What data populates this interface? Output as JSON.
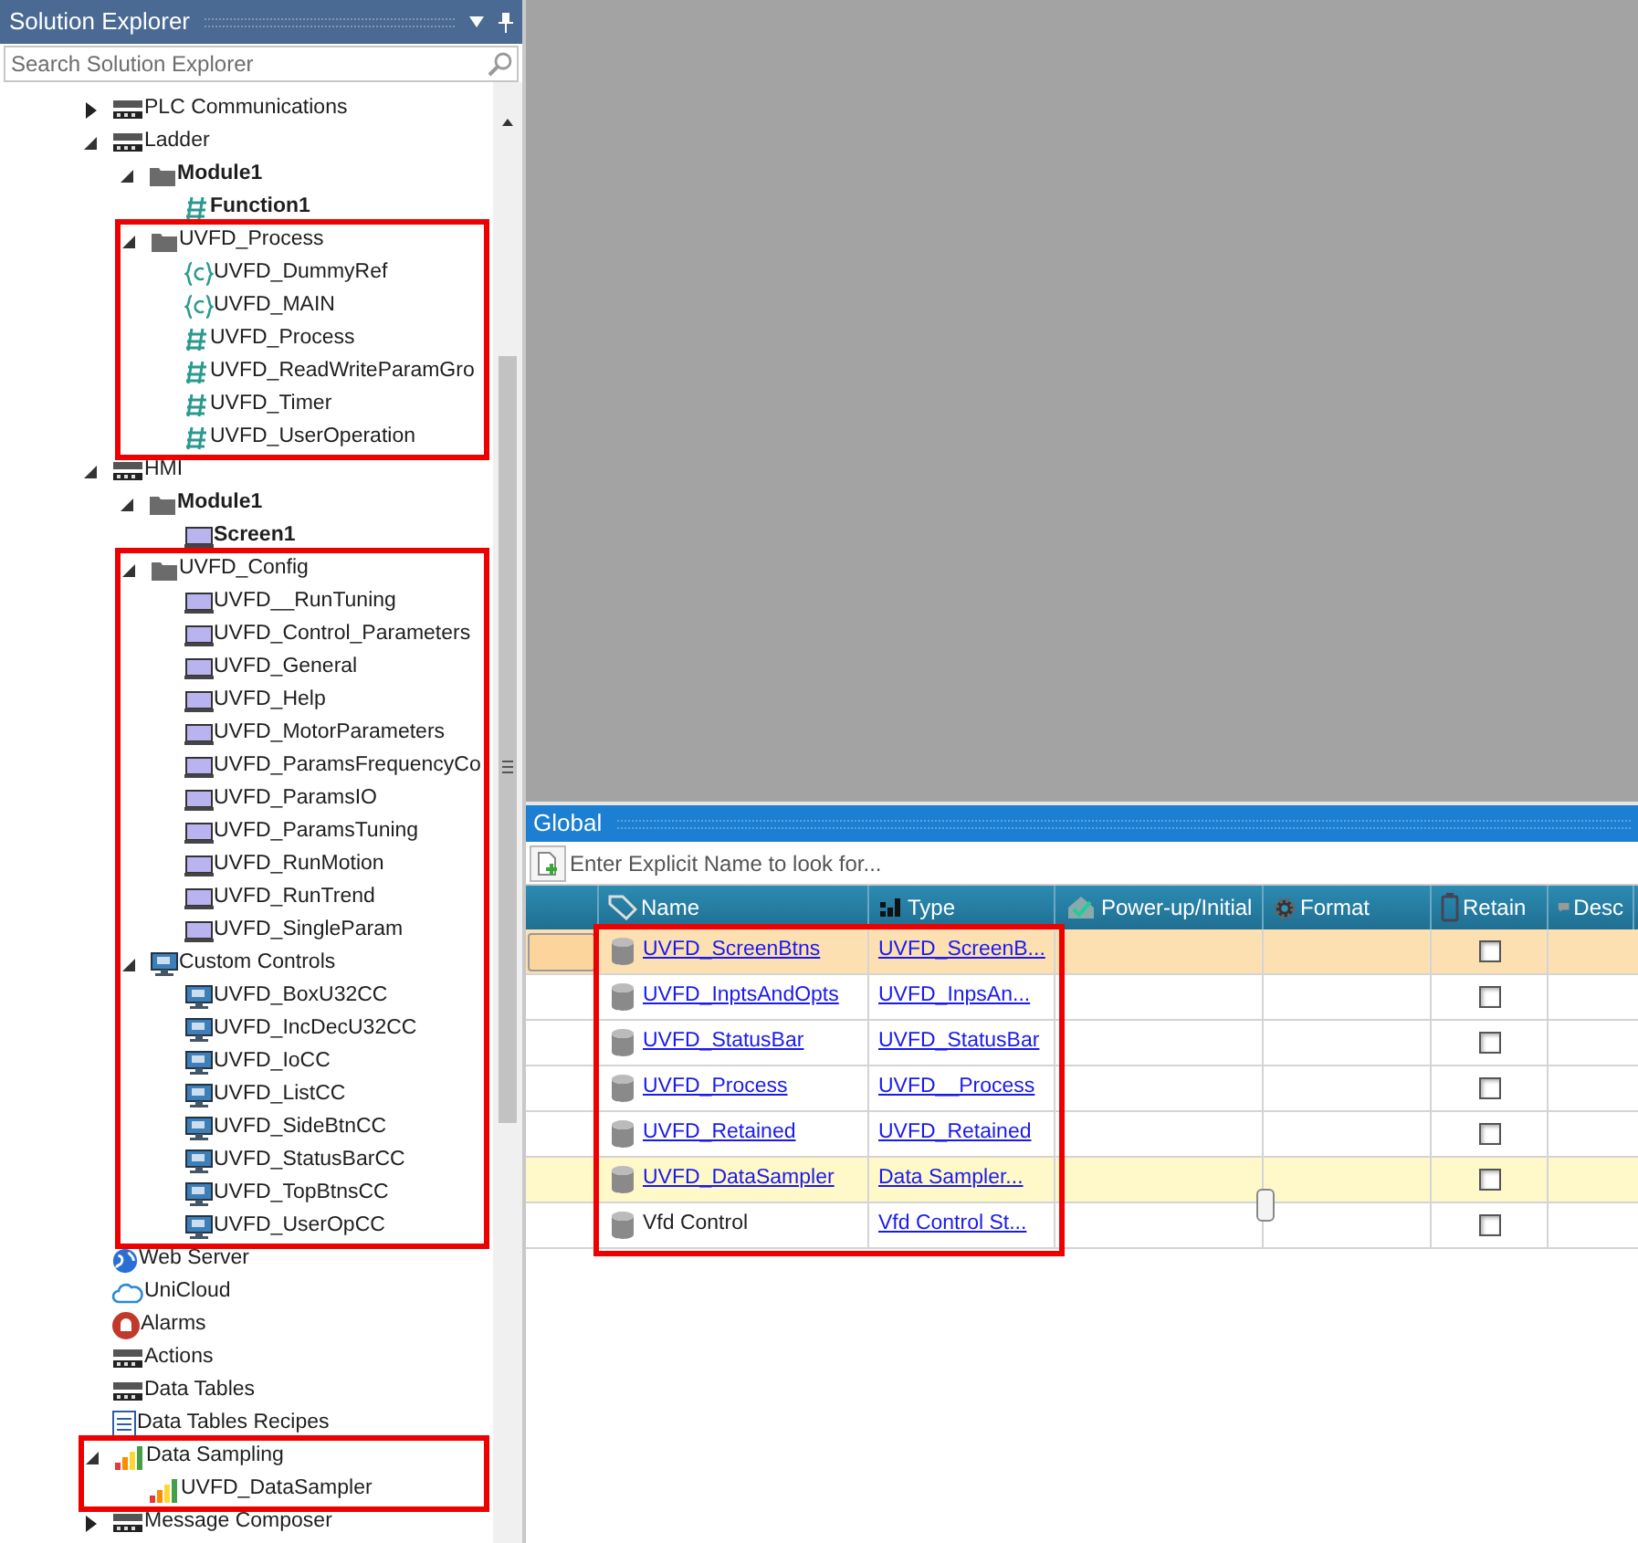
{
  "explorer": {
    "title": "Solution Explorer",
    "search": {
      "placeholder": "Search Solution Explorer"
    },
    "tree": [
      {
        "label": "PLC Communications",
        "kind": "com",
        "expanded": false
      },
      {
        "label": "Ladder",
        "kind": "ldr",
        "expanded": true,
        "children": [
          {
            "label": "Module1",
            "kind": "folder",
            "bold": true,
            "expanded": true,
            "children": [
              {
                "label": "Function1",
                "kind": "ladder",
                "bold": true
              }
            ]
          },
          {
            "label": "UVFD_Process",
            "kind": "folder",
            "expanded": true,
            "highlighted": true,
            "children": [
              {
                "label": "UVFD_DummyRef",
                "kind": "code"
              },
              {
                "label": "UVFD_MAIN",
                "kind": "code"
              },
              {
                "label": "UVFD_Process",
                "kind": "ladder"
              },
              {
                "label": "UVFD_ReadWriteParamGro",
                "kind": "ladder"
              },
              {
                "label": "UVFD_Timer",
                "kind": "ladder"
              },
              {
                "label": "UVFD_UserOperation",
                "kind": "ladder"
              }
            ]
          }
        ]
      },
      {
        "label": "HMI",
        "kind": "hmi",
        "expanded": true,
        "children": [
          {
            "label": "Module1",
            "kind": "folder",
            "bold": true,
            "expanded": true,
            "children": [
              {
                "label": "Screen1",
                "kind": "screen",
                "bold": true
              }
            ]
          },
          {
            "label": "UVFD_Config",
            "kind": "folder",
            "expanded": true,
            "highlighted": true,
            "children": [
              {
                "label": "UVFD__RunTuning",
                "kind": "screen"
              },
              {
                "label": "UVFD_Control_Parameters",
                "kind": "screen"
              },
              {
                "label": "UVFD_General",
                "kind": "screen"
              },
              {
                "label": "UVFD_Help",
                "kind": "screen"
              },
              {
                "label": "UVFD_MotorParameters",
                "kind": "screen"
              },
              {
                "label": "UVFD_ParamsFrequencyCo",
                "kind": "screen"
              },
              {
                "label": "UVFD_ParamsIO",
                "kind": "screen"
              },
              {
                "label": "UVFD_ParamsTuning",
                "kind": "screen"
              },
              {
                "label": "UVFD_RunMotion",
                "kind": "screen"
              },
              {
                "label": "UVFD_RunTrend",
                "kind": "screen"
              },
              {
                "label": "UVFD_SingleParam",
                "kind": "screen"
              }
            ]
          },
          {
            "label": "Custom Controls",
            "kind": "monitor",
            "expanded": true,
            "highlighted": true,
            "children": [
              {
                "label": "UVFD_BoxU32CC",
                "kind": "monitor"
              },
              {
                "label": "UVFD_IncDecU32CC",
                "kind": "monitor"
              },
              {
                "label": "UVFD_IoCC",
                "kind": "monitor"
              },
              {
                "label": "UVFD_ListCC",
                "kind": "monitor"
              },
              {
                "label": "UVFD_SideBtnCC",
                "kind": "monitor"
              },
              {
                "label": "UVFD_StatusBarCC",
                "kind": "monitor"
              },
              {
                "label": "UVFD_TopBtnsCC",
                "kind": "monitor"
              },
              {
                "label": "UVFD_UserOpCC",
                "kind": "monitor"
              }
            ]
          }
        ]
      },
      {
        "label": "Web Server",
        "kind": "globe"
      },
      {
        "label": "UniCloud",
        "kind": "cloud"
      },
      {
        "label": "Alarms",
        "kind": "alarm"
      },
      {
        "label": "Actions",
        "kind": "act"
      },
      {
        "label": "Data Tables",
        "kind": "dt"
      },
      {
        "label": "Data Tables Recipes",
        "kind": "recipe"
      },
      {
        "label": "Data Sampling",
        "kind": "chart",
        "expanded": true,
        "highlighted": true,
        "children": [
          {
            "label": "UVFD_DataSampler",
            "kind": "chart"
          }
        ]
      },
      {
        "label": "Message Composer",
        "kind": "com",
        "expanded": false
      }
    ]
  },
  "global": {
    "title": "Global",
    "search": {
      "placeholder": "Enter Explicit Name to look for..."
    },
    "columns": [
      {
        "label": "Name",
        "kind": "tag",
        "highlighted": true
      },
      {
        "label": "Type",
        "kind": "type",
        "highlighted": true
      },
      {
        "label": "Power-up/Initial",
        "kind": "power"
      },
      {
        "label": "Format",
        "kind": "gear"
      },
      {
        "label": "Retain",
        "kind": "battery"
      },
      {
        "label": "Desc",
        "kind": "comment"
      }
    ],
    "rows": [
      {
        "name": "UVFD_ScreenBtns",
        "name_link": true,
        "type": "UVFD_ScreenB...",
        "retain": false,
        "selected": true,
        "hovered": false
      },
      {
        "name": "UVFD_InptsAndOpts",
        "name_link": true,
        "type": "UVFD_InpsAn...",
        "retain": false,
        "selected": false,
        "hovered": false
      },
      {
        "name": "UVFD_StatusBar",
        "name_link": true,
        "type": "UVFD_StatusBar",
        "retain": false,
        "selected": false,
        "hovered": false
      },
      {
        "name": "UVFD_Process",
        "name_link": true,
        "type": "UVFD__Process",
        "retain": false,
        "selected": false,
        "hovered": false
      },
      {
        "name": "UVFD_Retained",
        "name_link": true,
        "type": "UVFD_Retained",
        "retain": false,
        "selected": false,
        "hovered": false
      },
      {
        "name": "UVFD_DataSampler",
        "name_link": true,
        "type": "Data Sampler...",
        "retain": false,
        "selected": false,
        "hovered": true
      },
      {
        "name": "Vfd Control",
        "name_link": false,
        "type": "Vfd Control St...",
        "retain": false,
        "selected": false,
        "hovered": false
      }
    ]
  }
}
